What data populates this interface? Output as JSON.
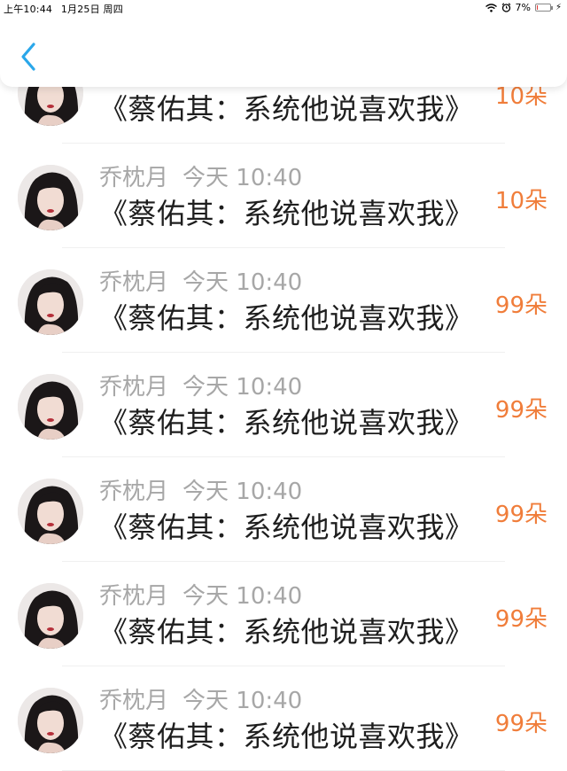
{
  "status_bar": {
    "time": "上午10:44",
    "date": "1月25日 周四",
    "wifi_icon": "wifi-icon",
    "alarm_icon": "alarm-icon",
    "battery_percent": "7%",
    "battery_level": 0.07,
    "battery_color": "#e53935"
  },
  "nav": {
    "back_icon": "chevron-left-icon",
    "accent": "#2aa7ea"
  },
  "rows": [
    {
      "name": "",
      "time": "",
      "title": "《蔡佑其：系统他说喜欢我》",
      "amount": "10朵"
    },
    {
      "name": "乔枕月",
      "time": "今天 10:40",
      "title": "《蔡佑其：系统他说喜欢我》",
      "amount": "10朵"
    },
    {
      "name": "乔枕月",
      "time": "今天 10:40",
      "title": "《蔡佑其：系统他说喜欢我》",
      "amount": "99朵"
    },
    {
      "name": "乔枕月",
      "time": "今天 10:40",
      "title": "《蔡佑其：系统他说喜欢我》",
      "amount": "99朵"
    },
    {
      "name": "乔枕月",
      "time": "今天 10:40",
      "title": "《蔡佑其：系统他说喜欢我》",
      "amount": "99朵"
    },
    {
      "name": "乔枕月",
      "time": "今天 10:40",
      "title": "《蔡佑其：系统他说喜欢我》",
      "amount": "99朵"
    },
    {
      "name": "乔枕月",
      "time": "今天 10:40",
      "title": "《蔡佑其：系统他说喜欢我》",
      "amount": "99朵"
    }
  ],
  "colors": {
    "amount": "#f07d3a",
    "secondary_text": "#a7a7a7",
    "primary_text": "#1e1e1e"
  }
}
